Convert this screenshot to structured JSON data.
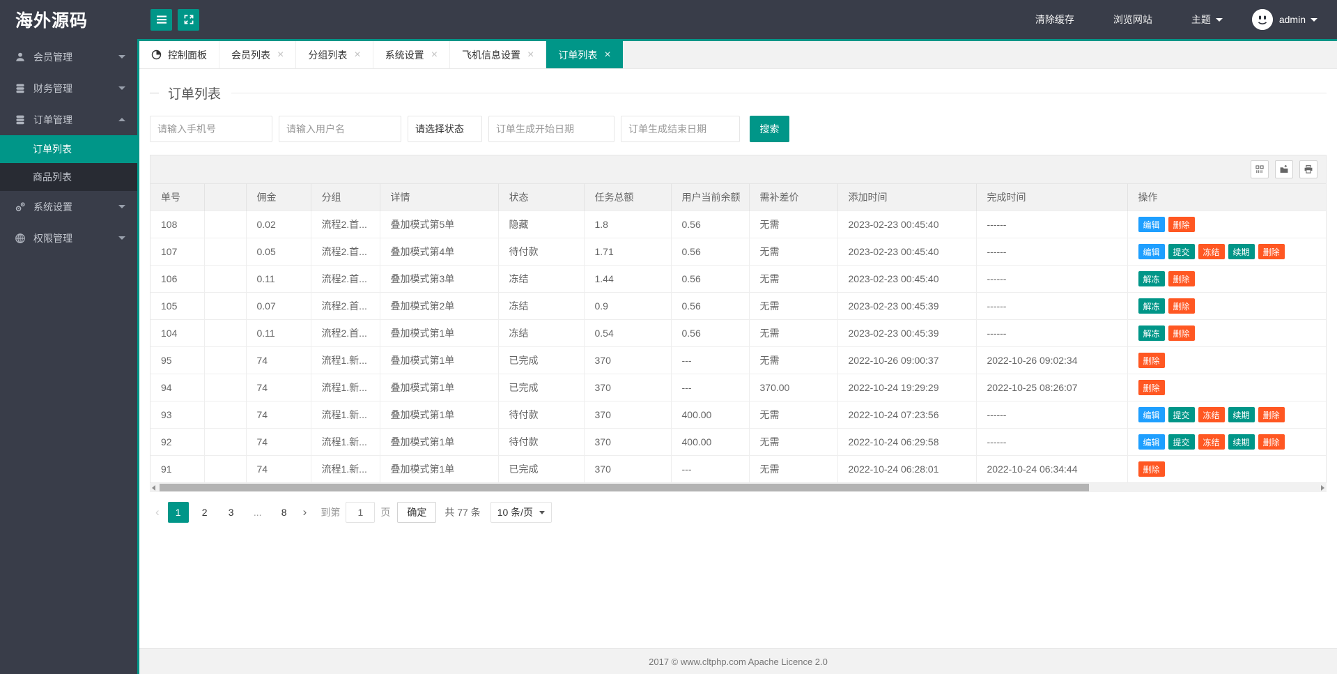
{
  "colors": {
    "teal": "#009688",
    "blue": "#1E9FFF",
    "orange": "#FF5722",
    "dark": "#393D49"
  },
  "brand": {
    "logo_text": "海外源码"
  },
  "topbar": {
    "clear_cache": "清除缓存",
    "browse_site": "浏览网站",
    "theme": "主题",
    "username": "admin"
  },
  "sidebar": {
    "items": [
      {
        "label": "会员管理",
        "icon": "user-icon",
        "expanded": false
      },
      {
        "label": "财务管理",
        "icon": "finance-icon",
        "expanded": false
      },
      {
        "label": "订单管理",
        "icon": "order-icon",
        "expanded": true,
        "children": [
          {
            "label": "订单列表",
            "active": true
          },
          {
            "label": "商品列表",
            "active": false
          }
        ]
      },
      {
        "label": "系统设置",
        "icon": "gear-icon",
        "expanded": false
      },
      {
        "label": "权限管理",
        "icon": "globe-icon",
        "expanded": false
      }
    ]
  },
  "tabs": [
    {
      "label": "控制面板",
      "icon": "dashboard-icon",
      "closable": false,
      "active": false
    },
    {
      "label": "会员列表",
      "closable": true,
      "active": false
    },
    {
      "label": "分组列表",
      "closable": true,
      "active": false
    },
    {
      "label": "系统设置",
      "closable": true,
      "active": false
    },
    {
      "label": "飞机信息设置",
      "closable": true,
      "active": false
    },
    {
      "label": "订单列表",
      "closable": true,
      "active": true
    }
  ],
  "page": {
    "title": "订单列表"
  },
  "filters": {
    "phone_placeholder": "请输入手机号",
    "username_placeholder": "请输入用户名",
    "status_placeholder": "请选择状态",
    "start_date_placeholder": "订单生成开始日期",
    "end_date_placeholder": "订单生成结束日期",
    "search_label": "搜索"
  },
  "toolbar": {
    "icons": [
      "columns-icon",
      "export-icon",
      "print-icon"
    ]
  },
  "table": {
    "headers": [
      "单号",
      "",
      "佣金",
      "分组",
      "详情",
      "状态",
      "任务总额",
      "用户当前余额",
      "需补差价",
      "添加时间",
      "完成时间",
      "操作"
    ],
    "rows": [
      {
        "cells": [
          "108",
          "",
          "0.02",
          "流程2.首...",
          "叠加模式第5单",
          "隐藏",
          "1.8",
          "0.56",
          "无需",
          "2023-02-23 00:45:40",
          "------"
        ],
        "actions": [
          {
            "label": "编辑",
            "type": "blue"
          },
          {
            "label": "删除",
            "type": "orange"
          }
        ]
      },
      {
        "cells": [
          "107",
          "",
          "0.05",
          "流程2.首...",
          "叠加模式第4单",
          "待付款",
          "1.71",
          "0.56",
          "无需",
          "2023-02-23 00:45:40",
          "------"
        ],
        "actions": [
          {
            "label": "编辑",
            "type": "blue"
          },
          {
            "label": "提交",
            "type": "teal"
          },
          {
            "label": "冻结",
            "type": "orange"
          },
          {
            "label": "续期",
            "type": "teal"
          },
          {
            "label": "删除",
            "type": "orange"
          }
        ]
      },
      {
        "cells": [
          "106",
          "",
          "0.11",
          "流程2.首...",
          "叠加模式第3单",
          "冻结",
          "1.44",
          "0.56",
          "无需",
          "2023-02-23 00:45:40",
          "------"
        ],
        "actions": [
          {
            "label": "解冻",
            "type": "teal"
          },
          {
            "label": "删除",
            "type": "orange"
          }
        ]
      },
      {
        "cells": [
          "105",
          "",
          "0.07",
          "流程2.首...",
          "叠加模式第2单",
          "冻结",
          "0.9",
          "0.56",
          "无需",
          "2023-02-23 00:45:39",
          "------"
        ],
        "actions": [
          {
            "label": "解冻",
            "type": "teal"
          },
          {
            "label": "删除",
            "type": "orange"
          }
        ]
      },
      {
        "cells": [
          "104",
          "",
          "0.11",
          "流程2.首...",
          "叠加模式第1单",
          "冻结",
          "0.54",
          "0.56",
          "无需",
          "2023-02-23 00:45:39",
          "------"
        ],
        "actions": [
          {
            "label": "解冻",
            "type": "teal"
          },
          {
            "label": "删除",
            "type": "orange"
          }
        ]
      },
      {
        "cells": [
          "95",
          "",
          "74",
          "流程1.新...",
          "叠加模式第1单",
          "已完成",
          "370",
          "---",
          "无需",
          "2022-10-26 09:00:37",
          "2022-10-26 09:02:34"
        ],
        "actions": [
          {
            "label": "删除",
            "type": "orange"
          }
        ]
      },
      {
        "cells": [
          "94",
          "",
          "74",
          "流程1.新...",
          "叠加模式第1单",
          "已完成",
          "370",
          "---",
          "370.00",
          "2022-10-24 19:29:29",
          "2022-10-25 08:26:07"
        ],
        "actions": [
          {
            "label": "删除",
            "type": "orange"
          }
        ]
      },
      {
        "cells": [
          "93",
          "",
          "74",
          "流程1.新...",
          "叠加模式第1单",
          "待付款",
          "370",
          "400.00",
          "无需",
          "2022-10-24 07:23:56",
          "------"
        ],
        "actions": [
          {
            "label": "编辑",
            "type": "blue"
          },
          {
            "label": "提交",
            "type": "teal"
          },
          {
            "label": "冻结",
            "type": "orange"
          },
          {
            "label": "续期",
            "type": "teal"
          },
          {
            "label": "删除",
            "type": "orange"
          }
        ]
      },
      {
        "cells": [
          "92",
          "",
          "74",
          "流程1.新...",
          "叠加模式第1单",
          "待付款",
          "370",
          "400.00",
          "无需",
          "2022-10-24 06:29:58",
          "------"
        ],
        "actions": [
          {
            "label": "编辑",
            "type": "blue"
          },
          {
            "label": "提交",
            "type": "teal"
          },
          {
            "label": "冻结",
            "type": "orange"
          },
          {
            "label": "续期",
            "type": "teal"
          },
          {
            "label": "删除",
            "type": "orange"
          }
        ]
      },
      {
        "cells": [
          "91",
          "",
          "74",
          "流程1.新...",
          "叠加模式第1单",
          "已完成",
          "370",
          "---",
          "无需",
          "2022-10-24 06:28:01",
          "2022-10-24 06:34:44"
        ],
        "actions": [
          {
            "label": "删除",
            "type": "orange"
          }
        ]
      }
    ]
  },
  "pagination": {
    "prev": "‹",
    "next": "›",
    "pages": [
      {
        "label": "1",
        "active": true
      },
      {
        "label": "2",
        "active": false
      },
      {
        "label": "3",
        "active": false
      },
      {
        "label": "...",
        "active": false
      },
      {
        "label": "8",
        "active": false
      }
    ],
    "goto_label": "到第",
    "goto_value": "1",
    "goto_unit": "页",
    "confirm_label": "确定",
    "total_label": "共 77 条",
    "page_size_label": "10 条/页"
  },
  "footer": {
    "copyright": "2017 © www.cltphp.com Apache Licence 2.0"
  }
}
